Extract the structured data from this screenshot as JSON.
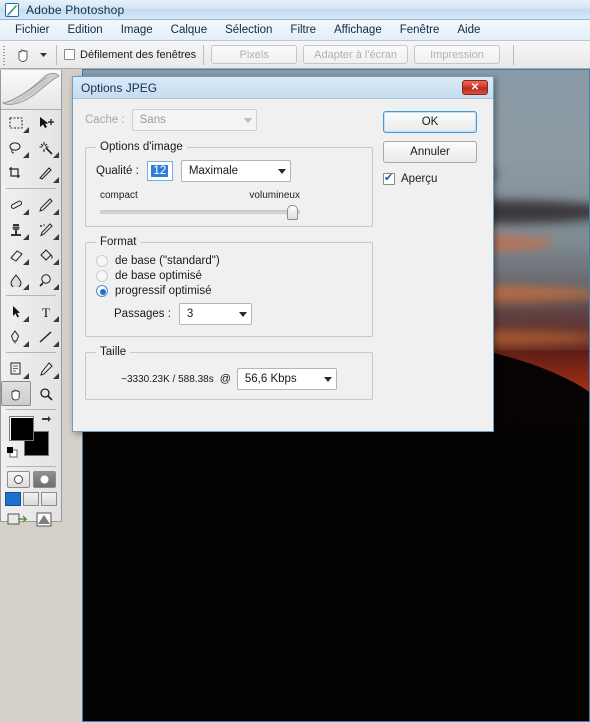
{
  "app": {
    "title": "Adobe Photoshop",
    "icon": "photoshop-feather-icon"
  },
  "menubar": {
    "items": [
      {
        "label": "Fichier"
      },
      {
        "label": "Edition"
      },
      {
        "label": "Image"
      },
      {
        "label": "Calque"
      },
      {
        "label": "Sélection"
      },
      {
        "label": "Filtre"
      },
      {
        "label": "Affichage"
      },
      {
        "label": "Fenêtre"
      },
      {
        "label": "Aide"
      }
    ]
  },
  "options_bar": {
    "tool_icon": "hand-tool-icon",
    "dropdown_icon": "chevron-down-icon",
    "scroll_windows_label": "Défilement des fenêtres",
    "scroll_windows_checked": false,
    "buttons": [
      {
        "label": "Pixels",
        "disabled": true
      },
      {
        "label": "Adapter à l'écran",
        "disabled": true
      },
      {
        "label": "Impression",
        "disabled": true
      }
    ]
  },
  "toolbar": {
    "tools": [
      {
        "name": "rectangular-marquee-tool",
        "glyph": "▭"
      },
      {
        "name": "move-tool",
        "glyph": "✥"
      },
      {
        "name": "lasso-tool",
        "glyph": "◯"
      },
      {
        "name": "magic-wand-tool",
        "glyph": "✳"
      },
      {
        "name": "crop-tool",
        "glyph": "⌗"
      },
      {
        "name": "slice-tool",
        "glyph": "✂"
      },
      {
        "name": "healing-brush-tool",
        "glyph": "⊘"
      },
      {
        "name": "brush-tool",
        "glyph": "✎"
      },
      {
        "name": "clone-stamp-tool",
        "glyph": "⎙"
      },
      {
        "name": "history-brush-tool",
        "glyph": "✒"
      },
      {
        "name": "eraser-tool",
        "glyph": "▱"
      },
      {
        "name": "gradient-tool",
        "glyph": "◨"
      },
      {
        "name": "blur-tool",
        "glyph": "☂"
      },
      {
        "name": "dodge-tool",
        "glyph": "◍"
      },
      {
        "name": "path-selection-tool",
        "glyph": "➤"
      },
      {
        "name": "type-tool",
        "glyph": "T"
      },
      {
        "name": "pen-tool",
        "glyph": "✑"
      },
      {
        "name": "line-tool",
        "glyph": "╲"
      },
      {
        "name": "notes-tool",
        "glyph": "▤"
      },
      {
        "name": "eyedropper-tool",
        "glyph": "⌕"
      },
      {
        "name": "hand-tool",
        "glyph": "✋",
        "selected": true
      },
      {
        "name": "zoom-tool",
        "glyph": "⌕"
      }
    ],
    "foreground_color": "#000000",
    "background_color": "#000000",
    "swap-colors-icon": "⇄",
    "quickmask_icons": [
      "standard-mask-icon",
      "quick-mask-icon"
    ],
    "screen_mode_icons": [
      "standard-screen-icon",
      "full-screen-menubar-icon",
      "full-screen-icon"
    ],
    "jump_icons": [
      "jump-to-imageready-icon",
      "edit-in-imageready-icon"
    ]
  },
  "dialog": {
    "title": "Options JPEG",
    "close_icon": "close-icon",
    "cache": {
      "label": "Cache :",
      "value": "Sans",
      "disabled": true
    },
    "image_options": {
      "legend": "Options d'image",
      "quality_label": "Qualité :",
      "quality_value": "12",
      "quality_preset": "Maximale",
      "slider_min_label": "compact",
      "slider_max_label": "volumineux",
      "slider_position_pct": 100
    },
    "format": {
      "legend": "Format",
      "options": [
        {
          "label": "de base  (\"standard\")",
          "selected": false,
          "dimmed": true
        },
        {
          "label": "de base optimisé",
          "selected": false,
          "dimmed": true
        },
        {
          "label": "progressif optimisé",
          "selected": true,
          "dimmed": false
        }
      ],
      "passes_label": "Passages :",
      "passes_value": "3"
    },
    "size": {
      "legend": "Taille",
      "estimate": "~3330.23K / 588.38s",
      "at_symbol": "@",
      "speed": "56,6 Kbps"
    },
    "ok_label": "OK",
    "cancel_label": "Annuler",
    "preview_label": "Aperçu",
    "preview_checked": true
  },
  "colors": {
    "accent_blue": "#1f6fd0",
    "title_blue": "#0e2e4c",
    "close_red": "#cf3a2a",
    "sunset_orange": "#ec5416",
    "sky_gray": "#8a9aa6"
  }
}
